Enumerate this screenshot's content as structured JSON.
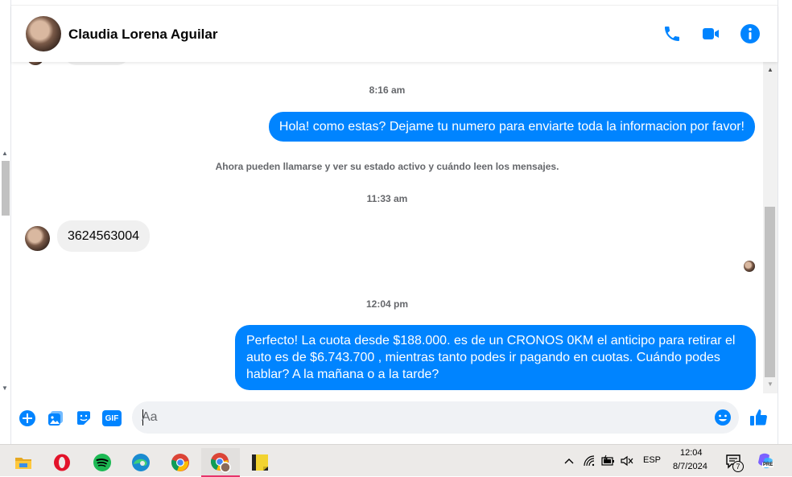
{
  "contact": {
    "name": "Claudia Lorena Aguilar"
  },
  "header_icons": [
    "phone-icon",
    "video-icon",
    "info-icon"
  ],
  "messages": {
    "stamp_1": "8:16 am",
    "out_1": "Hola! como estas? Dejame tu numero para enviarte toda la informacion por favor!",
    "notice": "Ahora pueden llamarse y ver su estado activo y cuándo leen los mensajes.",
    "stamp_2": "11:33 am",
    "in_1": "3624563004",
    "stamp_3": "12:04 pm",
    "out_2": "Perfecto! La cuota desde $188.000. es de un CRONOS 0KM el anticipo para retirar el auto es de $6.743.700 , mientras tanto podes ir pagando en cuotas. Cuándo podes hablar? A la mañana o a la tarde?"
  },
  "composer": {
    "placeholder": "Aa",
    "gif_label": "GIF"
  },
  "taskbar": {
    "apps": [
      "file-explorer",
      "opera",
      "spotify",
      "edge",
      "chrome",
      "chrome-profile",
      "sticky-notes"
    ],
    "language": "ESP",
    "time": "12:04",
    "date": "8/7/2024",
    "notifications_count": "7",
    "copilot_badge": "PRE"
  },
  "colors": {
    "accent": "#0084ff",
    "incoming_bubble": "#f0f0f0",
    "taskbar": "#eceae8"
  }
}
